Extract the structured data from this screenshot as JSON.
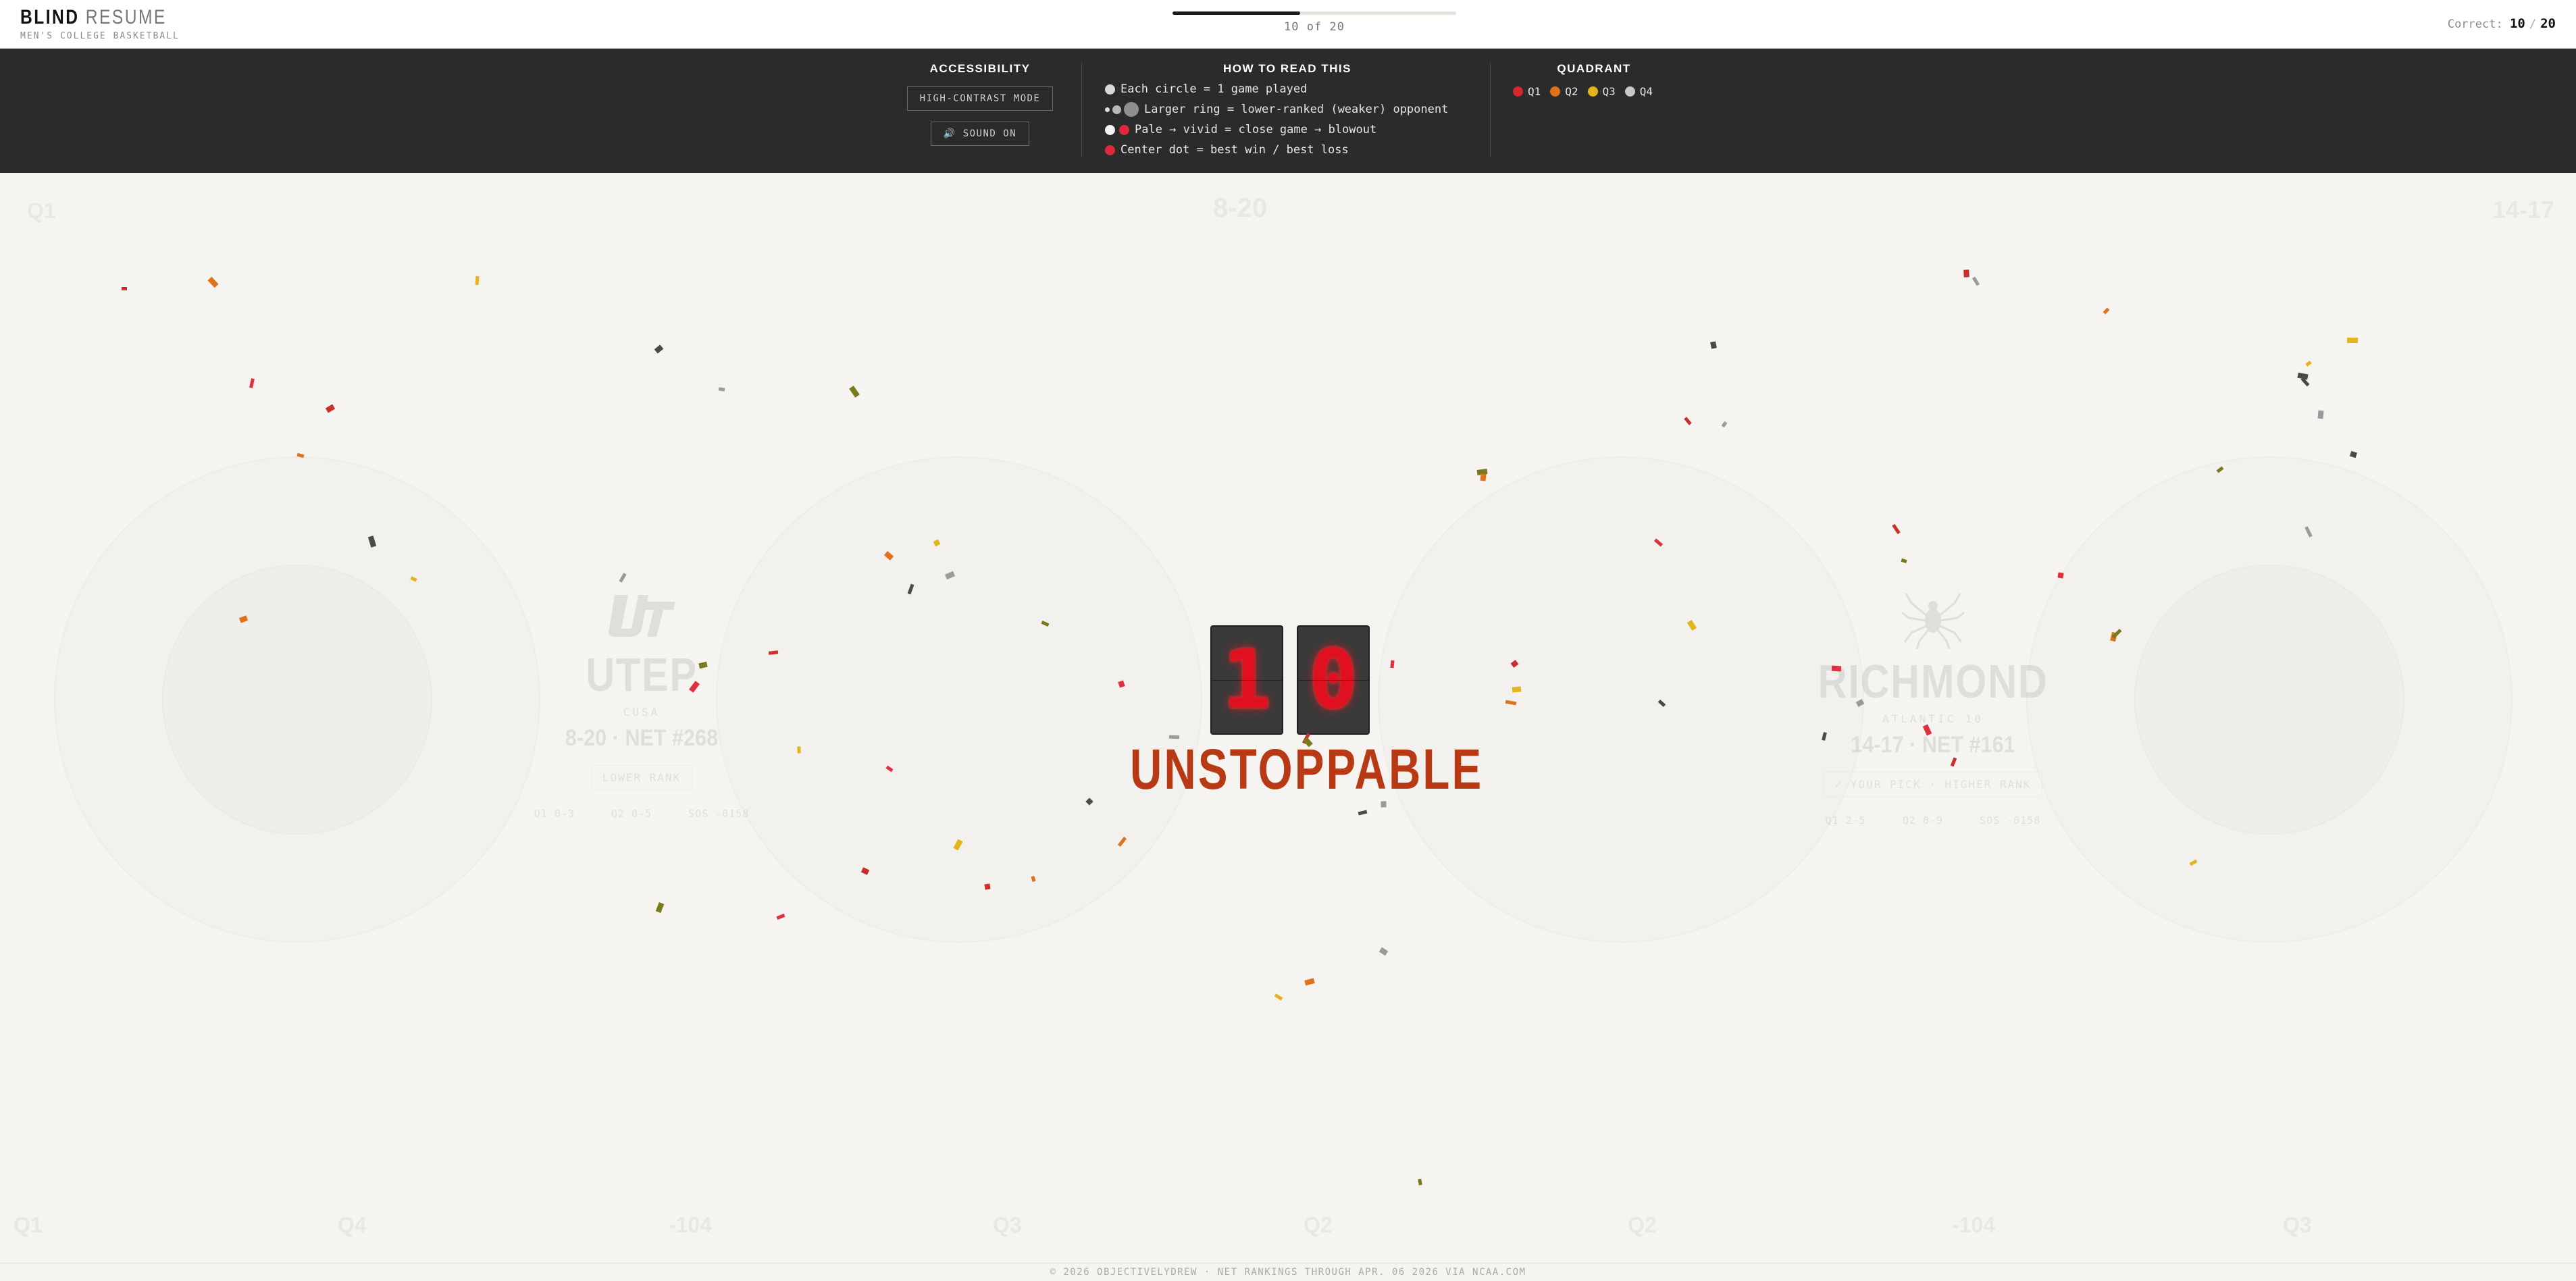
{
  "header": {
    "brand_primary": "BLIND",
    "brand_secondary": "RESUME",
    "subtitle": "MEN'S COLLEGE BASKETBALL",
    "progress_label": "10 of 20",
    "progress_fraction": 0.45,
    "score_label": "Correct:",
    "score_correct": "10",
    "score_total": "20"
  },
  "panel": {
    "accessibility": {
      "heading": "ACCESSIBILITY",
      "contrast_button": "HIGH-CONTRAST MODE",
      "sound_button": "🔊  SOUND ON"
    },
    "how_to": {
      "heading": "HOW TO READ THIS",
      "rows": [
        "Each circle = 1 game played",
        "Larger ring = lower-ranked (weaker) opponent",
        "Pale → vivid = close game → blowout",
        "Center dot = best win / best loss"
      ]
    },
    "quadrant": {
      "heading": "QUADRANT",
      "items": [
        {
          "label": "Q1",
          "color": "#d7262e"
        },
        {
          "label": "Q2",
          "color": "#e0721c"
        },
        {
          "label": "Q3",
          "color": "#e2b51c"
        },
        {
          "label": "Q4",
          "color": "#c9c9c9"
        }
      ]
    }
  },
  "teams": {
    "left": {
      "name": "UTEP",
      "conference": "CUSA",
      "record": "8-20 · NET #268",
      "pick_label": "LOWER RANK",
      "stats": [
        "Q1 0-3",
        "Q2 0-5",
        "SOS -0158"
      ]
    },
    "right": {
      "name": "RICHMOND",
      "conference": "ATLANTIC 10",
      "record": "14-17 · NET #161",
      "pick_label": "✓ YOUR PICK · HIGHER RANK",
      "stats": [
        "Q1 2-5",
        "Q2 0-9",
        "SOS -0158"
      ]
    }
  },
  "streak": {
    "digits": [
      "1",
      "0"
    ],
    "word": "UNSTOPPABLE"
  },
  "background_labels": {
    "top": [
      "Q1",
      "8-20",
      "14-17"
    ],
    "bottom": [
      "Q1",
      "Q4",
      "-104",
      "Q3",
      "Q2",
      "Q2",
      "-104",
      "Q3"
    ]
  },
  "footer": {
    "text": "© 2026 OBJECTIVELYDREW · NET RANKINGS THROUGH APR. 06 2026 VIA NCAA.COM"
  }
}
